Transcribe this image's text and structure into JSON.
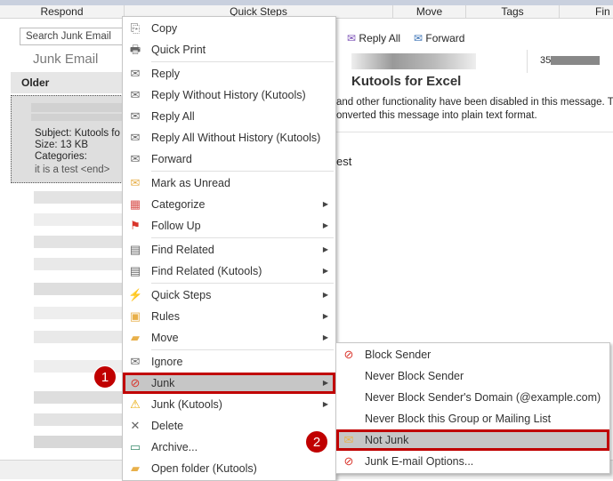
{
  "ribbon": {
    "groups": [
      "Respond",
      "Quick Steps",
      "Move",
      "Tags",
      "Fin"
    ]
  },
  "left": {
    "search_placeholder": "Search Junk Email",
    "folder": "Junk Email",
    "group": "Older",
    "selected": {
      "subject": "Subject: Kutools fo",
      "size": "Size: 13 KB",
      "categories": "Categories:",
      "preview": "it is a test  <end>"
    }
  },
  "reading": {
    "reply_all": "Reply All",
    "forward": "Forward",
    "sender_partial": "35",
    "title": "Kutools for Excel",
    "info1": "and other functionality have been disabled in this message. T",
    "info2": "onverted this message into plain text format.",
    "body": "est"
  },
  "menu": [
    {
      "label": "Copy",
      "icon": "copy-icon",
      "glyph": "⎘"
    },
    {
      "label": "Quick Print",
      "icon": "print-icon",
      "glyph": "🖶"
    },
    {
      "sep": true
    },
    {
      "label": "Reply",
      "icon": "reply-icon",
      "glyph": "✉"
    },
    {
      "label": "Reply Without History (Kutools)",
      "icon": "reply-kutools-icon",
      "glyph": "✉"
    },
    {
      "label": "Reply All",
      "icon": "reply-all-icon",
      "glyph": "✉"
    },
    {
      "label": "Reply All Without History (Kutools)",
      "icon": "reply-all-kutools-icon",
      "glyph": "✉"
    },
    {
      "label": "Forward",
      "icon": "forward-icon",
      "glyph": "✉"
    },
    {
      "sep": true
    },
    {
      "label": "Mark as Unread",
      "icon": "envelope-icon",
      "glyph": "✉",
      "color": "#e8b04a"
    },
    {
      "label": "Categorize",
      "icon": "categorize-icon",
      "glyph": "▦",
      "sub": true,
      "color": "#d9534f"
    },
    {
      "label": "Follow Up",
      "icon": "flag-icon",
      "glyph": "⚑",
      "sub": true,
      "color": "#d9342b"
    },
    {
      "sep": true
    },
    {
      "label": "Find Related",
      "icon": "find-related-icon",
      "glyph": "▤",
      "sub": true
    },
    {
      "label": "Find Related (Kutools)",
      "icon": "find-related-kutools-icon",
      "glyph": "▤",
      "sub": true
    },
    {
      "sep": true
    },
    {
      "label": "Quick Steps",
      "icon": "lightning-icon",
      "glyph": "⚡",
      "sub": true,
      "color": "#e8b04a"
    },
    {
      "label": "Rules",
      "icon": "rules-icon",
      "glyph": "▣",
      "sub": true,
      "color": "#e8b04a"
    },
    {
      "label": "Move",
      "icon": "move-folder-icon",
      "glyph": "▰",
      "sub": true,
      "color": "#e8b04a"
    },
    {
      "sep": true
    },
    {
      "label": "Ignore",
      "icon": "ignore-icon",
      "glyph": "✉"
    },
    {
      "label": "Junk",
      "icon": "junk-icon",
      "glyph": "⊘",
      "sub": true,
      "active": true,
      "color": "#d9342b"
    },
    {
      "label": "Junk (Kutools)",
      "icon": "junk-kutools-icon",
      "glyph": "⚠",
      "sub": true,
      "color": "#e8a800"
    },
    {
      "label": "Delete",
      "icon": "delete-icon",
      "glyph": "✕"
    },
    {
      "label": "Archive...",
      "icon": "archive-icon",
      "glyph": "▭",
      "color": "#3a8a6a"
    },
    {
      "label": "Open folder (Kutools)",
      "icon": "folder-icon",
      "glyph": "▰",
      "color": "#e8b04a"
    }
  ],
  "submenu": [
    {
      "label": "Block Sender",
      "icon": "block-sender-icon",
      "glyph": "⊘",
      "color": "#d9342b"
    },
    {
      "label": "Never Block Sender"
    },
    {
      "label": "Never Block Sender's Domain (@example.com)"
    },
    {
      "label": "Never Block this Group or Mailing List"
    },
    {
      "label": "Not Junk",
      "icon": "not-junk-icon",
      "glyph": "✉",
      "active": true,
      "color": "#e8b04a"
    },
    {
      "label": "Junk E-mail Options...",
      "icon": "junk-options-icon",
      "glyph": "⊘",
      "color": "#d9342b"
    }
  ],
  "badges": [
    "1",
    "2"
  ]
}
